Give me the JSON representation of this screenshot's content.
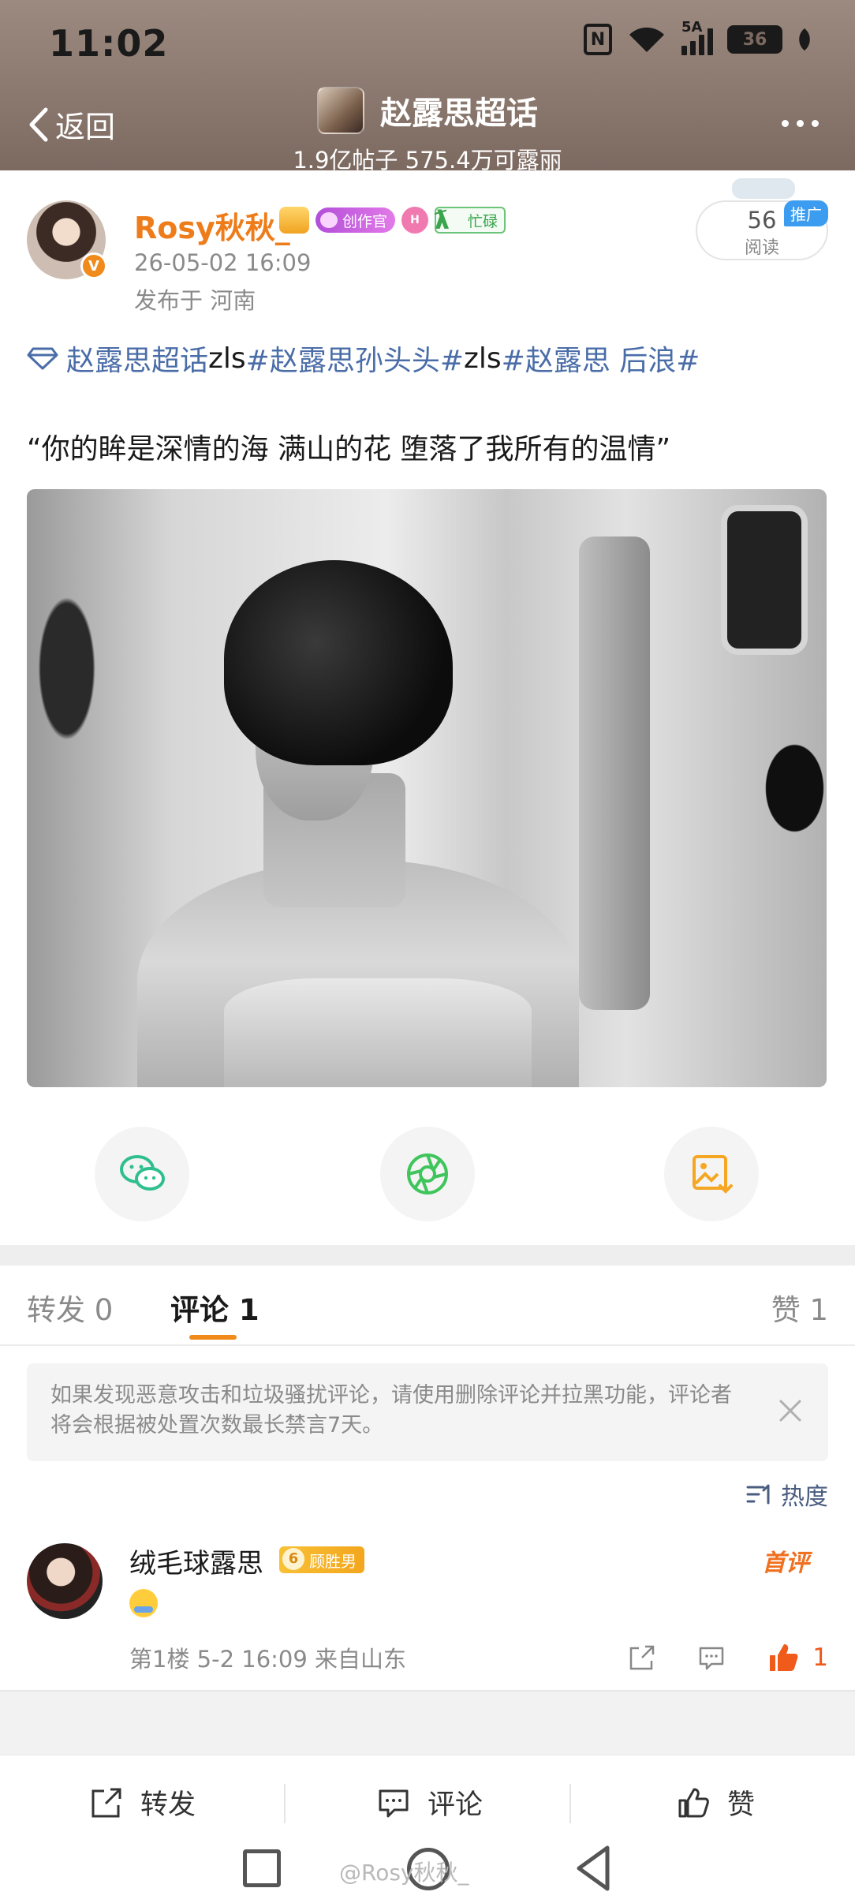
{
  "status_bar": {
    "time": "11:02",
    "network_label": "5A",
    "battery_level": "36"
  },
  "header": {
    "back_label": "返回",
    "topic_title": "赵露思超话",
    "topic_stats": "1.9亿帖子 575.4万可露丽"
  },
  "post": {
    "author": "Rosy秋秋_",
    "badge_creator": "创作官",
    "badge_level_text": "H",
    "badge_busy": "忙碌",
    "time": "26-05-02 16:09",
    "location": "发布于 河南",
    "reads_count": "56",
    "reads_label": "阅读",
    "promo_label": "推广",
    "tags": [
      {
        "text": "赵露思超话",
        "type": "tag"
      },
      {
        "text": "zls",
        "type": "plain"
      },
      {
        "text": "#赵露思孙头头#",
        "type": "tag"
      },
      {
        "text": " zls",
        "type": "plain"
      },
      {
        "text": "#赵露思 后浪#",
        "type": "tag"
      }
    ],
    "quote": "“你的眸是深情的海 满山的花 堕落了我所有的温情”"
  },
  "share_buttons": [
    "wechat-icon",
    "moments-icon",
    "save-image-icon"
  ],
  "tabs": {
    "repost": "转发 0",
    "comment": "评论 1",
    "like": "赞 1"
  },
  "notice": "如果发现恶意攻击和垃圾骚扰评论，请使用删除评论并拉黑功能，评论者将会根据被处置次数最长禁言7天。",
  "sort_label": "热度",
  "comment": {
    "name": "绒毛球露思",
    "badge": "顾胜男",
    "badge_level": "6",
    "first_label": "首评",
    "meta": "第1楼 5-2 16:09 来自山东",
    "like_count": "1"
  },
  "bottom_bar": {
    "repost": "转发",
    "comment": "评论",
    "like": "赞"
  },
  "watermark": "@Rosy秋秋_",
  "colors": {
    "accent": "#f08a1a",
    "link": "#4a6da8",
    "like": "#f05a1a",
    "header_bg": "#8b786e"
  }
}
